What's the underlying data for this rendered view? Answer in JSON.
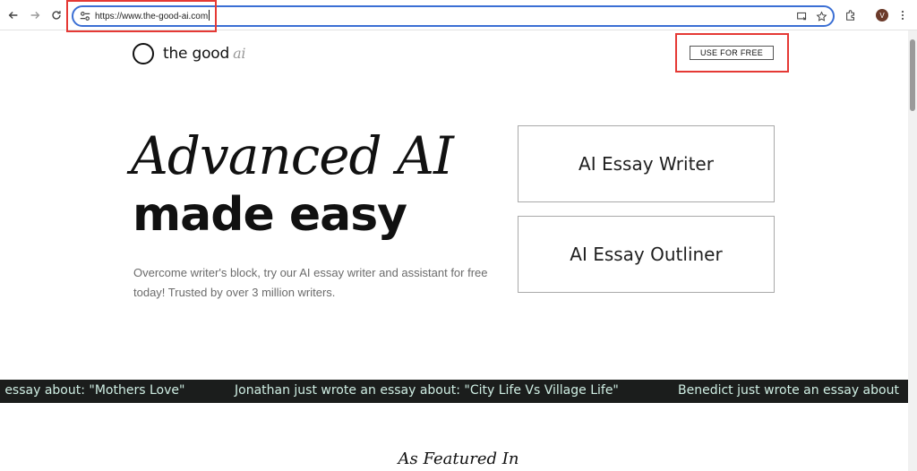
{
  "browser": {
    "url": "https://www.the-good-ai.com",
    "avatar_letter": "V"
  },
  "header": {
    "logo_main": "the good",
    "logo_accent": "ai",
    "cta_label": "USE FOR FREE"
  },
  "hero": {
    "line1": "Advanced AI",
    "line2": "made easy",
    "description": "Overcome writer's block, try our AI essay writer and assistant for free today! Trusted by over 3 million writers."
  },
  "tools": [
    {
      "label": "AI Essay Writer"
    },
    {
      "label": "AI Essay Outliner"
    }
  ],
  "ticker": [
    {
      "text": "n essay about: \"Mothers Love\""
    },
    {
      "text": "Jonathan just wrote an essay about: \"City Life Vs Village Life\""
    },
    {
      "text": "Benedict just wrote an essay about"
    }
  ],
  "featured": {
    "heading": "As Featured In"
  },
  "colors": {
    "accent_blue": "#3b6fd4",
    "highlight_red": "#e53935",
    "ticker_bg": "#1b1d1c",
    "ticker_text": "#cfeee3"
  }
}
